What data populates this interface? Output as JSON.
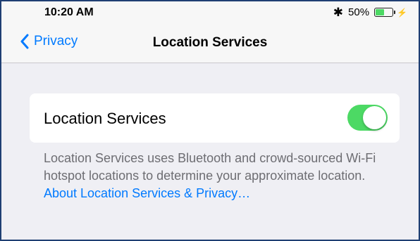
{
  "status_bar": {
    "time": "10:20 AM",
    "bluetooth_icon": "bluetooth-icon",
    "battery_percent": "50%",
    "battery_level": 0.5,
    "charging_icon": "bolt-icon"
  },
  "nav": {
    "back_label": "Privacy",
    "back_icon": "chevron-left-icon",
    "title": "Location Services"
  },
  "setting": {
    "label": "Location Services",
    "enabled": true,
    "toggle_on_color": "#4cd964"
  },
  "footer": {
    "text": "Location Services uses Bluetooth and crowd-sourced Wi-Fi hotspot locations to determine your approximate location.",
    "link": "About Location Services & Privacy…",
    "link_color": "#007aff"
  }
}
